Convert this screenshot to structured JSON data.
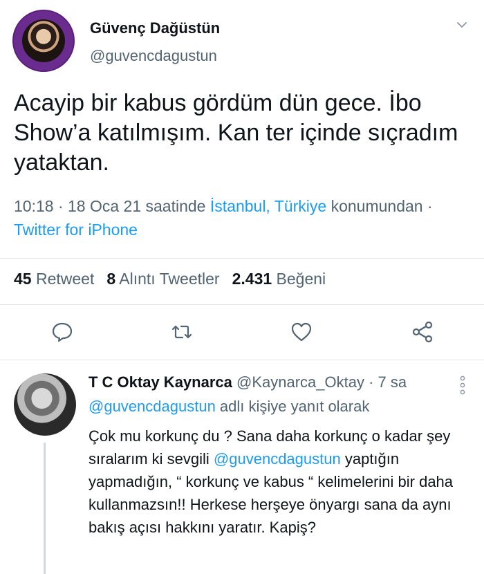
{
  "tweet": {
    "display_name": "Güvenç Dağüstün",
    "handle": "@guvencdagustun",
    "text": "Acayip bir kabus gördüm dün gece. İbo Show’a katılmışım. Kan ter içinde sıçradım yataktan.",
    "time_date": "10:18 · 18 Oca 21 saatinde ",
    "location": "İstanbul, Türkiye",
    "location_suffix": " konumundan · ",
    "source": "Twitter for iPhone",
    "retweet_count": "45",
    "retweet_label": "Retweet",
    "quote_count": "8",
    "quote_label": "Alıntı Tweetler",
    "like_count": "2.431",
    "like_label": "Beğeni",
    "icons": [
      "chevron-down-icon",
      "reply-icon",
      "retweet-icon",
      "like-icon",
      "share-icon"
    ]
  },
  "reply": {
    "display_name": "T C Oktay Kaynarca",
    "handle": "@Kaynarca_Oktay",
    "time": "· 7 sa",
    "replying_to_handle": "@guvencdagustun",
    "replying_to_suffix": " adlı kişiye yanıt olarak",
    "text_part1": "Çok mu korkunç du ? Sana daha korkunç o kadar şey sıralarım ki sevgili ",
    "mention": "@guvencdagustun",
    "text_part2": " yaptığın yapmadığın,  “ korkunç ve kabus “ kelimelerini bir daha kullanmazsın!! Herkese herşeye önyargı sana da aynı bakış açısı hakkını yaratır. Kapiş?"
  },
  "colors": {
    "link": "#1d9bf0",
    "secondary_text": "#536471",
    "primary_text": "#0f1419",
    "divider": "#dfe3e6"
  }
}
